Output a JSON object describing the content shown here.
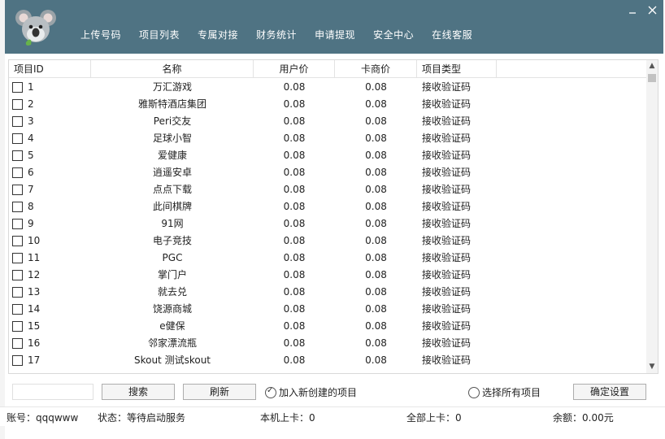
{
  "nav": [
    "上传号码",
    "项目列表",
    "专属对接",
    "财务统计",
    "申请提现",
    "安全中心",
    "在线客服"
  ],
  "window": {
    "minimize_icon": "minimize-icon",
    "close_icon": "close-icon"
  },
  "table": {
    "headers": {
      "id": "项目ID",
      "name": "名称",
      "user_price": "用户价",
      "card_price": "卡商价",
      "type": "项目类型"
    },
    "rows": [
      {
        "id": "1",
        "name": "万汇游戏",
        "user_price": "0.08",
        "card_price": "0.08",
        "type": "接收验证码"
      },
      {
        "id": "2",
        "name": "雅斯特酒店集团",
        "user_price": "0.08",
        "card_price": "0.08",
        "type": "接收验证码"
      },
      {
        "id": "3",
        "name": "Peri交友",
        "user_price": "0.08",
        "card_price": "0.08",
        "type": "接收验证码"
      },
      {
        "id": "4",
        "name": "足球小智",
        "user_price": "0.08",
        "card_price": "0.08",
        "type": "接收验证码"
      },
      {
        "id": "5",
        "name": "爱健康",
        "user_price": "0.08",
        "card_price": "0.08",
        "type": "接收验证码"
      },
      {
        "id": "6",
        "name": "逍遥安卓",
        "user_price": "0.08",
        "card_price": "0.08",
        "type": "接收验证码"
      },
      {
        "id": "7",
        "name": "点点下载",
        "user_price": "0.08",
        "card_price": "0.08",
        "type": "接收验证码"
      },
      {
        "id": "8",
        "name": "此间棋牌",
        "user_price": "0.08",
        "card_price": "0.08",
        "type": "接收验证码"
      },
      {
        "id": "9",
        "name": "91网",
        "user_price": "0.08",
        "card_price": "0.08",
        "type": "接收验证码"
      },
      {
        "id": "10",
        "name": "电子竞技",
        "user_price": "0.08",
        "card_price": "0.08",
        "type": "接收验证码"
      },
      {
        "id": "11",
        "name": "PGC",
        "user_price": "0.08",
        "card_price": "0.08",
        "type": "接收验证码"
      },
      {
        "id": "12",
        "name": "掌门户",
        "user_price": "0.08",
        "card_price": "0.08",
        "type": "接收验证码"
      },
      {
        "id": "13",
        "name": "就去兑",
        "user_price": "0.08",
        "card_price": "0.08",
        "type": "接收验证码"
      },
      {
        "id": "14",
        "name": "饶源商城",
        "user_price": "0.08",
        "card_price": "0.08",
        "type": "接收验证码"
      },
      {
        "id": "15",
        "name": "e健保",
        "user_price": "0.08",
        "card_price": "0.08",
        "type": "接收验证码"
      },
      {
        "id": "16",
        "name": "邻家漂流瓶",
        "user_price": "0.08",
        "card_price": "0.08",
        "type": "接收验证码"
      },
      {
        "id": "17",
        "name": "Skout 测试skout",
        "user_price": "0.08",
        "card_price": "0.08",
        "type": "接收验证码"
      }
    ]
  },
  "controls": {
    "search_value": "",
    "search_button": "搜索",
    "refresh_button": "刷新",
    "add_new_label": "加入新创建的项目",
    "add_new_checked": true,
    "select_all_label": "选择所有项目",
    "select_all_checked": false,
    "confirm_button": "确定设置"
  },
  "status": {
    "account": "账号：qqqwww",
    "state": "状态：等待启动服务",
    "local_cards": "本机上卡：0",
    "all_cards": "全部上卡：0",
    "balance": "余额：0.00元"
  }
}
